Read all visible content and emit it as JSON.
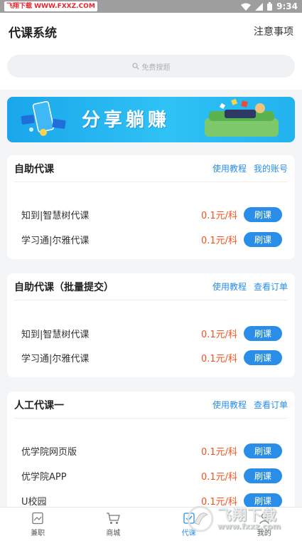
{
  "status_bar": {
    "watermark": "飞翔下载 WWW.FXXZ.COM",
    "time": "9:34"
  },
  "header": {
    "title": "代课系统",
    "notice": "注意事项"
  },
  "search": {
    "placeholder": "免费搜题"
  },
  "banner": {
    "text": "分享躺赚"
  },
  "sections": [
    {
      "title": "自助代课",
      "links": [
        "使用教程",
        "我的账号"
      ],
      "rows": [
        {
          "name": "知到|智慧树代课",
          "price": "0.1元/科",
          "button": "刷课"
        },
        {
          "name": "学习通|尔雅代课",
          "price": "0.1元/科",
          "button": "刷课"
        }
      ]
    },
    {
      "title": "自助代课（批量提交）",
      "links": [
        "使用教程",
        "查看订单"
      ],
      "rows": [
        {
          "name": "知到|智慧树代课",
          "price": "0.1元/科",
          "button": "刷课"
        },
        {
          "name": "学习通|尔雅代课",
          "price": "0.1元/科",
          "button": "刷课"
        }
      ]
    },
    {
      "title": "人工代课一",
      "links": [
        "使用教程",
        "查看订单"
      ],
      "rows": [
        {
          "name": "优学院网页版",
          "price": "0.1元/科",
          "button": "刷课"
        },
        {
          "name": "优学院APP",
          "price": "0.1元/科",
          "button": "刷课"
        },
        {
          "name": "U校园",
          "price": "0.1元/科",
          "button": "刷课"
        }
      ]
    }
  ],
  "tabbar": {
    "tabs": [
      {
        "label": "兼职",
        "icon": "document-icon"
      },
      {
        "label": "商城",
        "icon": "cart-icon"
      },
      {
        "label": "代课",
        "icon": "course-icon"
      },
      {
        "label": "我的",
        "icon": "profile-icon"
      }
    ],
    "active": "代课"
  },
  "watermark_bottom": {
    "brand": "飞翔下载",
    "url": "www.fxxz.com"
  },
  "colors": {
    "accent": "#2a8ee8",
    "price": "#f4511e",
    "banner": "#1aa6ea"
  }
}
